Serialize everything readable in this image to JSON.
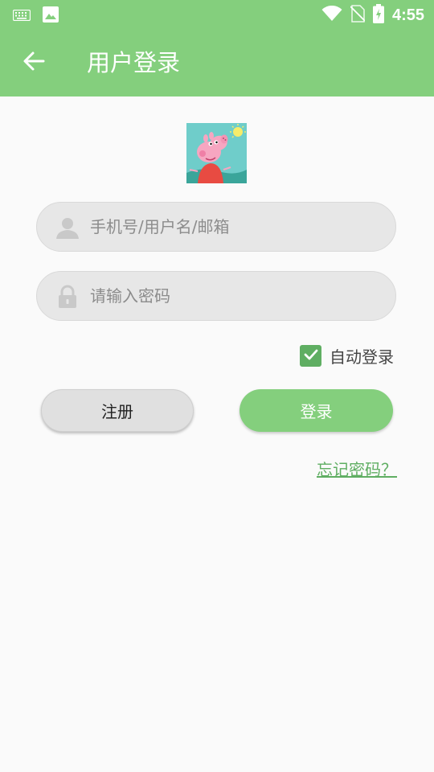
{
  "status_bar": {
    "time": "4:55",
    "icons": [
      "keyboard-icon",
      "image-icon",
      "wifi-icon",
      "no-sim-icon",
      "battery-charging-icon"
    ]
  },
  "app_bar": {
    "title": "用户登录",
    "back_icon": "arrow-left-icon"
  },
  "avatar": {
    "icon": "peppa-pig-avatar"
  },
  "login_form": {
    "username": {
      "value": "",
      "placeholder": "手机号/用户名/邮箱",
      "icon": "user-icon"
    },
    "password": {
      "value": "",
      "placeholder": "请输入密码",
      "icon": "lock-icon"
    },
    "auto_login": {
      "label": "自动登录",
      "checked": true
    }
  },
  "buttons": {
    "register_label": "注册",
    "login_label": "登录"
  },
  "forgot_password_label": "忘记密码？",
  "colors": {
    "primary": "#84cf7d",
    "accent": "#5fae62",
    "field_bg": "#e7e7e7",
    "background": "#fafafa"
  }
}
